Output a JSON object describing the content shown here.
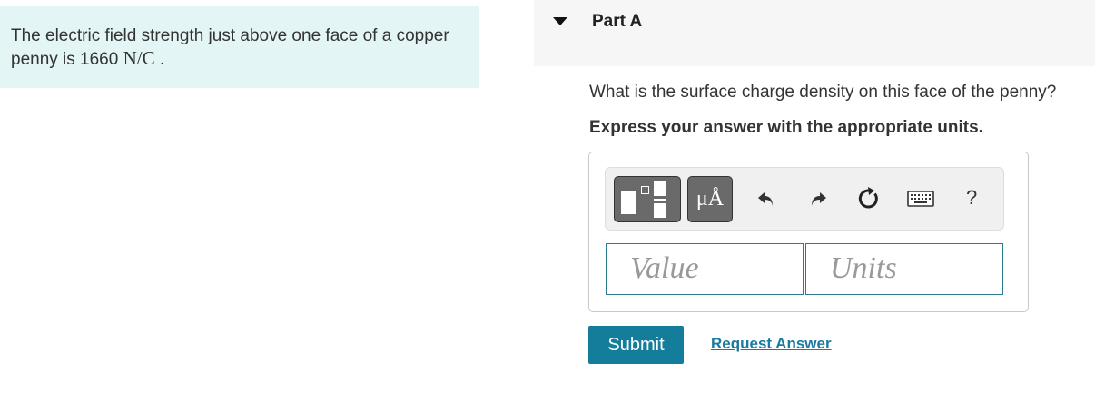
{
  "problem": {
    "text_before": "The electric field strength just above one face of a copper penny is 1660 ",
    "math": "N/C",
    "text_after": " ."
  },
  "part": {
    "title": "Part A",
    "question": "What is the surface charge density on this face of the penny?",
    "instruction": "Express your answer with the appropriate units."
  },
  "toolbar": {
    "units_label": "μÅ",
    "help_label": "?",
    "icons": [
      "templates-icon",
      "units-icon",
      "undo-icon",
      "redo-icon",
      "reset-icon",
      "keyboard-icon",
      "help-icon"
    ]
  },
  "answer": {
    "value_placeholder": "Value",
    "units_placeholder": "Units"
  },
  "actions": {
    "submit_label": "Submit",
    "request_answer_label": "Request Answer"
  },
  "colors": {
    "problem_bg": "#e4f5f5",
    "accent": "#147d9b",
    "link": "#1b7aa0",
    "field_border": "#2a7b8c"
  }
}
